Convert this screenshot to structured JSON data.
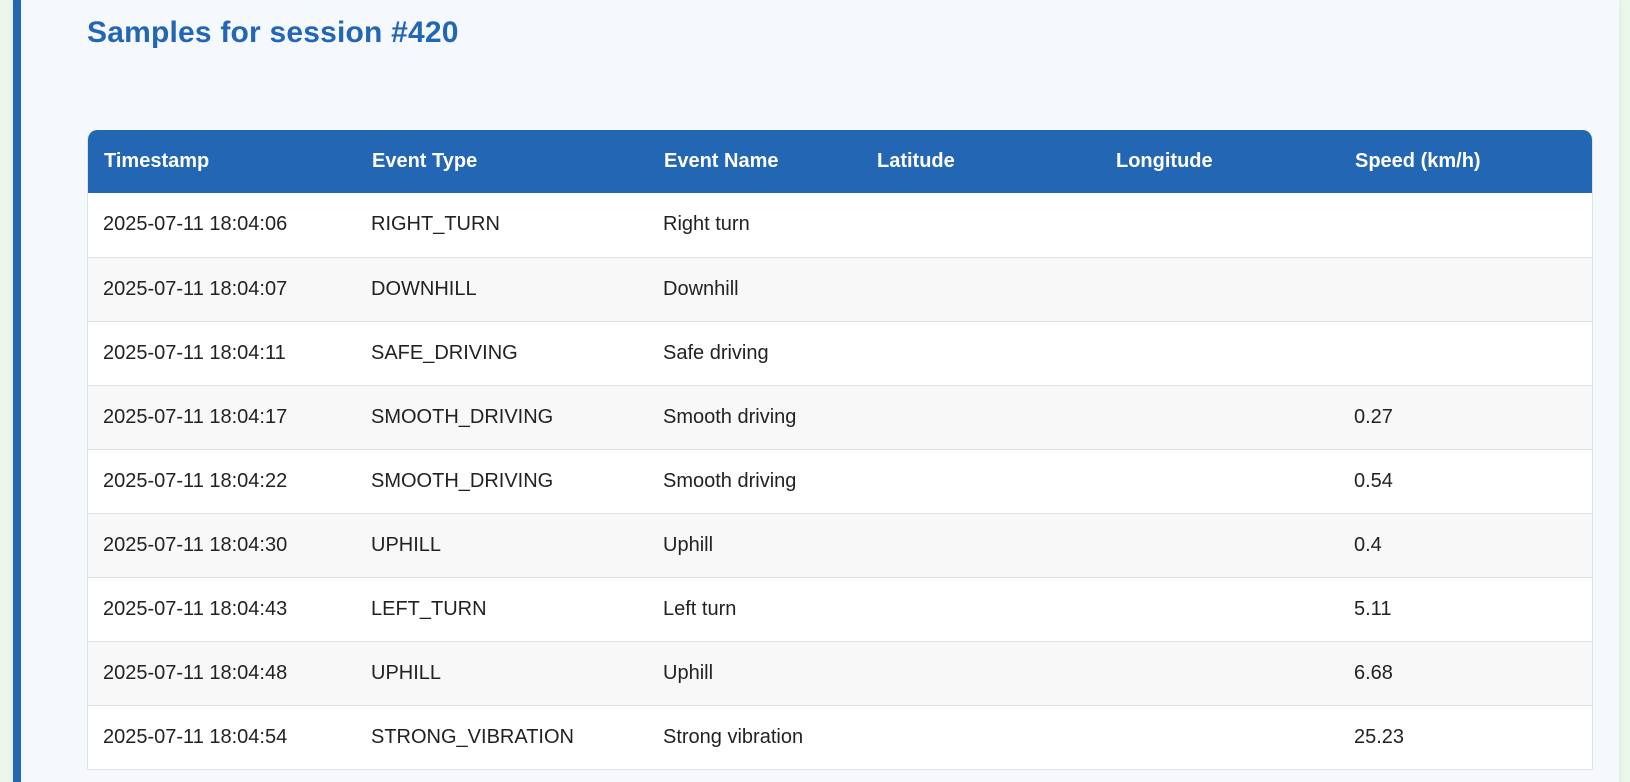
{
  "page": {
    "title": "Samples for session #420"
  },
  "table": {
    "headers": [
      "Timestamp",
      "Event Type",
      "Event Name",
      "Latitude",
      "Longitude",
      "Speed (km/h)"
    ],
    "rows": [
      {
        "timestamp": "2025-07-11 18:04:06",
        "event_type": "RIGHT_TURN",
        "event_name": "Right turn",
        "latitude": "",
        "longitude": "",
        "speed": ""
      },
      {
        "timestamp": "2025-07-11 18:04:07",
        "event_type": "DOWNHILL",
        "event_name": "Downhill",
        "latitude": "",
        "longitude": "",
        "speed": ""
      },
      {
        "timestamp": "2025-07-11 18:04:11",
        "event_type": "SAFE_DRIVING",
        "event_name": "Safe driving",
        "latitude": "",
        "longitude": "",
        "speed": ""
      },
      {
        "timestamp": "2025-07-11 18:04:17",
        "event_type": "SMOOTH_DRIVING",
        "event_name": "Smooth driving",
        "latitude": "",
        "longitude": "",
        "speed": "0.27"
      },
      {
        "timestamp": "2025-07-11 18:04:22",
        "event_type": "SMOOTH_DRIVING",
        "event_name": "Smooth driving",
        "latitude": "",
        "longitude": "",
        "speed": "0.54"
      },
      {
        "timestamp": "2025-07-11 18:04:30",
        "event_type": "UPHILL",
        "event_name": "Uphill",
        "latitude": "",
        "longitude": "",
        "speed": "0.4"
      },
      {
        "timestamp": "2025-07-11 18:04:43",
        "event_type": "LEFT_TURN",
        "event_name": "Left turn",
        "latitude": "",
        "longitude": "",
        "speed": "5.11"
      },
      {
        "timestamp": "2025-07-11 18:04:48",
        "event_type": "UPHILL",
        "event_name": "Uphill",
        "latitude": "",
        "longitude": "",
        "speed": "6.68"
      },
      {
        "timestamp": "2025-07-11 18:04:54",
        "event_type": "STRONG_VIBRATION",
        "event_name": "Strong vibration",
        "latitude": "",
        "longitude": "",
        "speed": "25.23"
      }
    ]
  },
  "colors": {
    "accent": "#2366b4",
    "page_background": "#f5f9fd",
    "outer_background": "#eaf7ea",
    "row_alt": "#f8f8f8"
  }
}
